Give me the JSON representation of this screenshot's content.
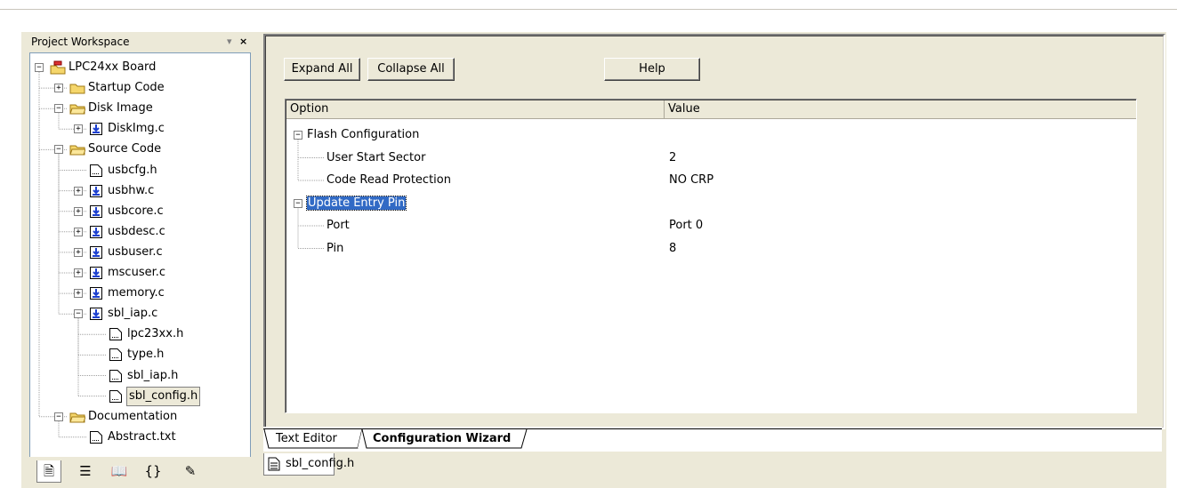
{
  "workspace": {
    "title": "Project Workspace",
    "pin_glyph": "▾",
    "close_glyph": "×",
    "tree": [
      {
        "label": "LPC24xx Board",
        "icon": "project-icon",
        "level": 0,
        "expander": "−"
      },
      {
        "label": "Startup Code",
        "icon": "folder-closed-icon",
        "level": 1,
        "expander": "+"
      },
      {
        "label": "Disk Image",
        "icon": "folder-open-icon",
        "level": 1,
        "expander": "−"
      },
      {
        "label": "DiskImg.c",
        "icon": "c-file-icon",
        "level": 2,
        "expander": "+"
      },
      {
        "label": "Source Code",
        "icon": "folder-open-icon",
        "level": 1,
        "expander": "−"
      },
      {
        "label": "usbcfg.h",
        "icon": "h-file-icon",
        "level": 2,
        "expander": ""
      },
      {
        "label": "usbhw.c",
        "icon": "c-file-icon",
        "level": 2,
        "expander": "+"
      },
      {
        "label": "usbcore.c",
        "icon": "c-file-icon",
        "level": 2,
        "expander": "+"
      },
      {
        "label": "usbdesc.c",
        "icon": "c-file-icon",
        "level": 2,
        "expander": "+"
      },
      {
        "label": "usbuser.c",
        "icon": "c-file-icon",
        "level": 2,
        "expander": "+"
      },
      {
        "label": "mscuser.c",
        "icon": "c-file-icon",
        "level": 2,
        "expander": "+"
      },
      {
        "label": "memory.c",
        "icon": "c-file-icon",
        "level": 2,
        "expander": "+"
      },
      {
        "label": "sbl_iap.c",
        "icon": "c-file-icon",
        "level": 2,
        "expander": "−"
      },
      {
        "label": "lpc23xx.h",
        "icon": "h-file-icon",
        "level": 3,
        "expander": ""
      },
      {
        "label": "type.h",
        "icon": "h-file-icon",
        "level": 3,
        "expander": ""
      },
      {
        "label": "sbl_iap.h",
        "icon": "h-file-icon",
        "level": 3,
        "expander": ""
      },
      {
        "label": "sbl_config.h",
        "icon": "h-file-icon",
        "level": 3,
        "expander": "",
        "selected": true
      },
      {
        "label": "Documentation",
        "icon": "folder-open-icon",
        "level": 1,
        "expander": "−"
      },
      {
        "label": "Abstract.txt",
        "icon": "h-file-icon",
        "level": 2,
        "expander": ""
      }
    ],
    "bottom_tabs": [
      {
        "icon": "files-tab-icon",
        "glyph": "🗎"
      },
      {
        "icon": "registers-tab-icon",
        "glyph": "☰"
      },
      {
        "icon": "books-tab-icon",
        "glyph": "📖"
      },
      {
        "icon": "functions-tab-icon",
        "glyph": "{}"
      },
      {
        "icon": "templates-tab-icon",
        "glyph": "✎"
      }
    ]
  },
  "wizard": {
    "expand_all": "Expand All",
    "collapse_all": "Collapse All",
    "help": "Help",
    "columns": {
      "option": "Option",
      "value": "Value"
    },
    "rows": [
      {
        "option": "Flash Configuration",
        "value": "",
        "level": 0,
        "expander": "−"
      },
      {
        "option": "User Start Sector",
        "value": "2",
        "level": 1
      },
      {
        "option": "Code Read Protection",
        "value": "NO CRP",
        "level": 1
      },
      {
        "option": "Update Entry Pin",
        "value": "",
        "level": 0,
        "expander": "−",
        "selected": true
      },
      {
        "option": "Port",
        "value": "Port 0",
        "level": 1
      },
      {
        "option": "Pin",
        "value": "8",
        "level": 1
      }
    ],
    "tabs": {
      "text_editor": "Text Editor",
      "config_wizard": "Configuration Wizard"
    },
    "document_tab": "sbl_config.h"
  },
  "colors": {
    "selection": "#316ac5",
    "face": "#ece9d8"
  }
}
